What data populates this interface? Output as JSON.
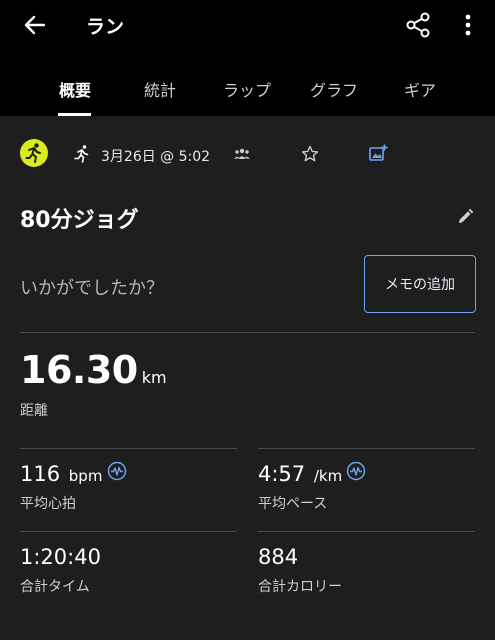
{
  "app_bar": {
    "title": "ラン"
  },
  "tabs": [
    {
      "label": "概要",
      "active": true
    },
    {
      "label": "統計",
      "active": false
    },
    {
      "label": "ラップ",
      "active": false
    },
    {
      "label": "グラフ",
      "active": false
    },
    {
      "label": "ギア",
      "active": false
    }
  ],
  "activity": {
    "date": "3月26日 @ 5:02",
    "title": "80分ジョグ",
    "badge_color": "#d9ec1f",
    "accent_color": "#6ea2f0"
  },
  "note": {
    "prompt": "いかがでしたか？",
    "add_button_label": "メモの追加"
  },
  "distance": {
    "value": "16.30",
    "unit": "km",
    "label": "距離"
  },
  "stats": [
    {
      "value": "116",
      "unit": "bpm",
      "label": "平均心拍",
      "icon": "heart-rate-icon"
    },
    {
      "value": "4:57",
      "unit": "/km",
      "label": "平均ペース",
      "icon": "pace-chart-icon"
    },
    {
      "value": "1:20:40",
      "unit": "",
      "label": "合計タイム"
    },
    {
      "value": "884",
      "unit": "",
      "label": "合計カロリー"
    }
  ]
}
